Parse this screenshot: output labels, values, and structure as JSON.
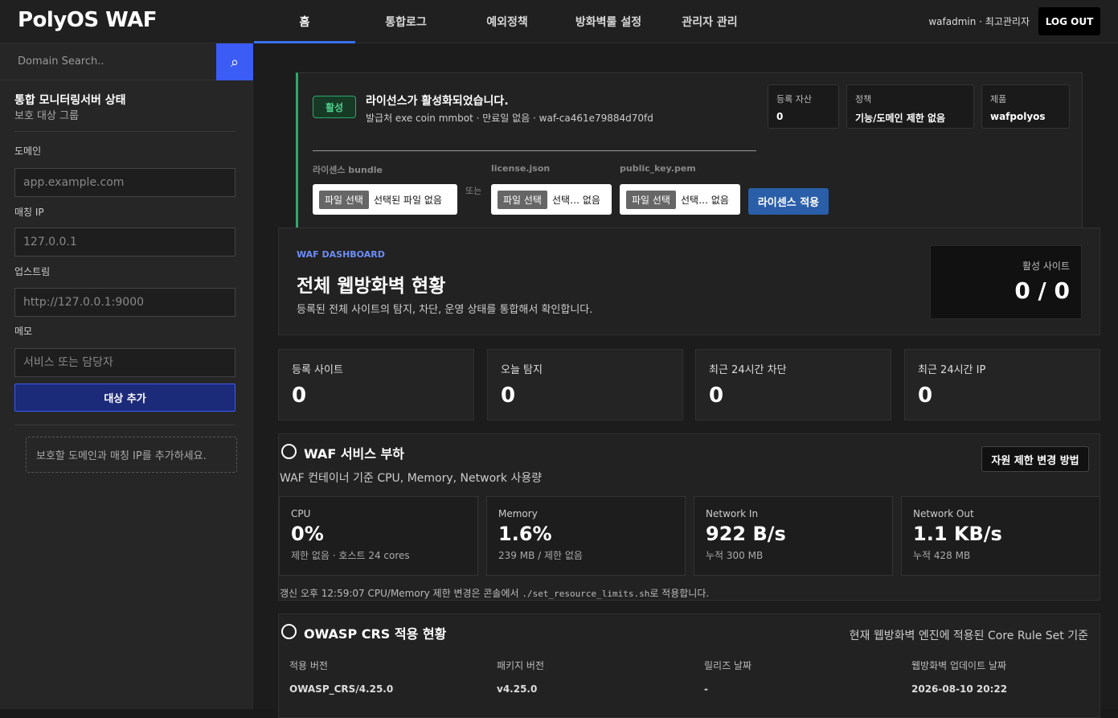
{
  "header": {
    "logo": "PolyOS WAF",
    "nav": [
      "홈",
      "통합로그",
      "예외정책",
      "방화벽룰 설정",
      "관리자 관리"
    ],
    "user": "wafadmin · 최고관리자",
    "logout": "LOG OUT"
  },
  "sidebar": {
    "search_placeholder": "Domain Search..",
    "search_icon": "search-icon",
    "title": "통합 모니터링서버 상태",
    "subtitle": "보호 대상 그룹",
    "domain_label": "도메인",
    "domain_placeholder": "app.example.com",
    "ip_label": "매칭 IP",
    "ip_placeholder": "127.0.0.1",
    "upstream_label": "업스트림",
    "upstream_placeholder": "http://127.0.0.1:9000",
    "memo_label": "메모",
    "memo_placeholder": "서비스 또는 담당자",
    "add_button": "대상 추가",
    "hint": "보호할 도메인과 매칭 IP를 추가하세요."
  },
  "license": {
    "badge": "활성",
    "title": "라이선스가 활성화되었습니다.",
    "subtitle": "발급처 exe coin mmbot · 만료일 없음 · waf-ca461e79884d70fd",
    "info": [
      {
        "key": "등록 자산",
        "value": "0"
      },
      {
        "key": "정책",
        "value": "기능/도메인 제한 없음"
      },
      {
        "key": "제품",
        "value": "wafpolyos"
      }
    ],
    "bundle_label": "라이센스 bundle",
    "json_label": "license.json",
    "pem_label": "public_key.pem",
    "or": "또는",
    "file_button": "파일 선택",
    "file_none_full": "선택된 파일 없음",
    "file_none_short": "선택… 없음",
    "apply": "라이센스 적용"
  },
  "dashboard": {
    "tag": "WAF DASHBOARD",
    "title": "전체 웹방화벽 현황",
    "desc": "등록된 전체 사이트의 탐지, 차단, 운영 상태를 통합해서 확인합니다.",
    "active_label": "활성 사이트",
    "active_value": "0 / 0"
  },
  "stats": [
    {
      "label": "등록 사이트",
      "value": "0"
    },
    {
      "label": "오늘 탐지",
      "value": "0"
    },
    {
      "label": "최근 24시간 차단",
      "value": "0"
    },
    {
      "label": "최근 24시간 IP",
      "value": "0"
    }
  ],
  "load": {
    "title": "WAF 서비스 부하",
    "subtitle": "WAF 컨테이너 기준 CPU, Memory, Network 사용량",
    "button": "자원 제한 변경 방법",
    "metrics": [
      {
        "label": "CPU",
        "value": "0%",
        "sub": "제한 없음 · 호스트 24 cores"
      },
      {
        "label": "Memory",
        "value": "1.6%",
        "sub": "239 MB / 제한 없음"
      },
      {
        "label": "Network In",
        "value": "922 B/s",
        "sub": "누적 300 MB"
      },
      {
        "label": "Network Out",
        "value": "1.1 KB/s",
        "sub": "누적 428 MB"
      }
    ],
    "update_prefix": "갱신 오후 12:59:07   CPU/Memory 제한 변경은 콘솔에서 ",
    "update_cmd": "./set_resource_limits.sh",
    "update_suffix": "로 적용합니다."
  },
  "crs": {
    "title": "OWASP CRS 적용 현황",
    "note": "현재 웹방화벽 엔진에 적용된 Core Rule Set 기준",
    "cols": [
      {
        "key": "적용 버전",
        "value": "OWASP_CRS/4.25.0"
      },
      {
        "key": "패키지 버전",
        "value": "v4.25.0"
      },
      {
        "key": "릴리즈 날짜",
        "value": "-"
      },
      {
        "key": "웹방화벽 업데이트 날짜",
        "value": "2026-08-10 20:22"
      }
    ]
  }
}
